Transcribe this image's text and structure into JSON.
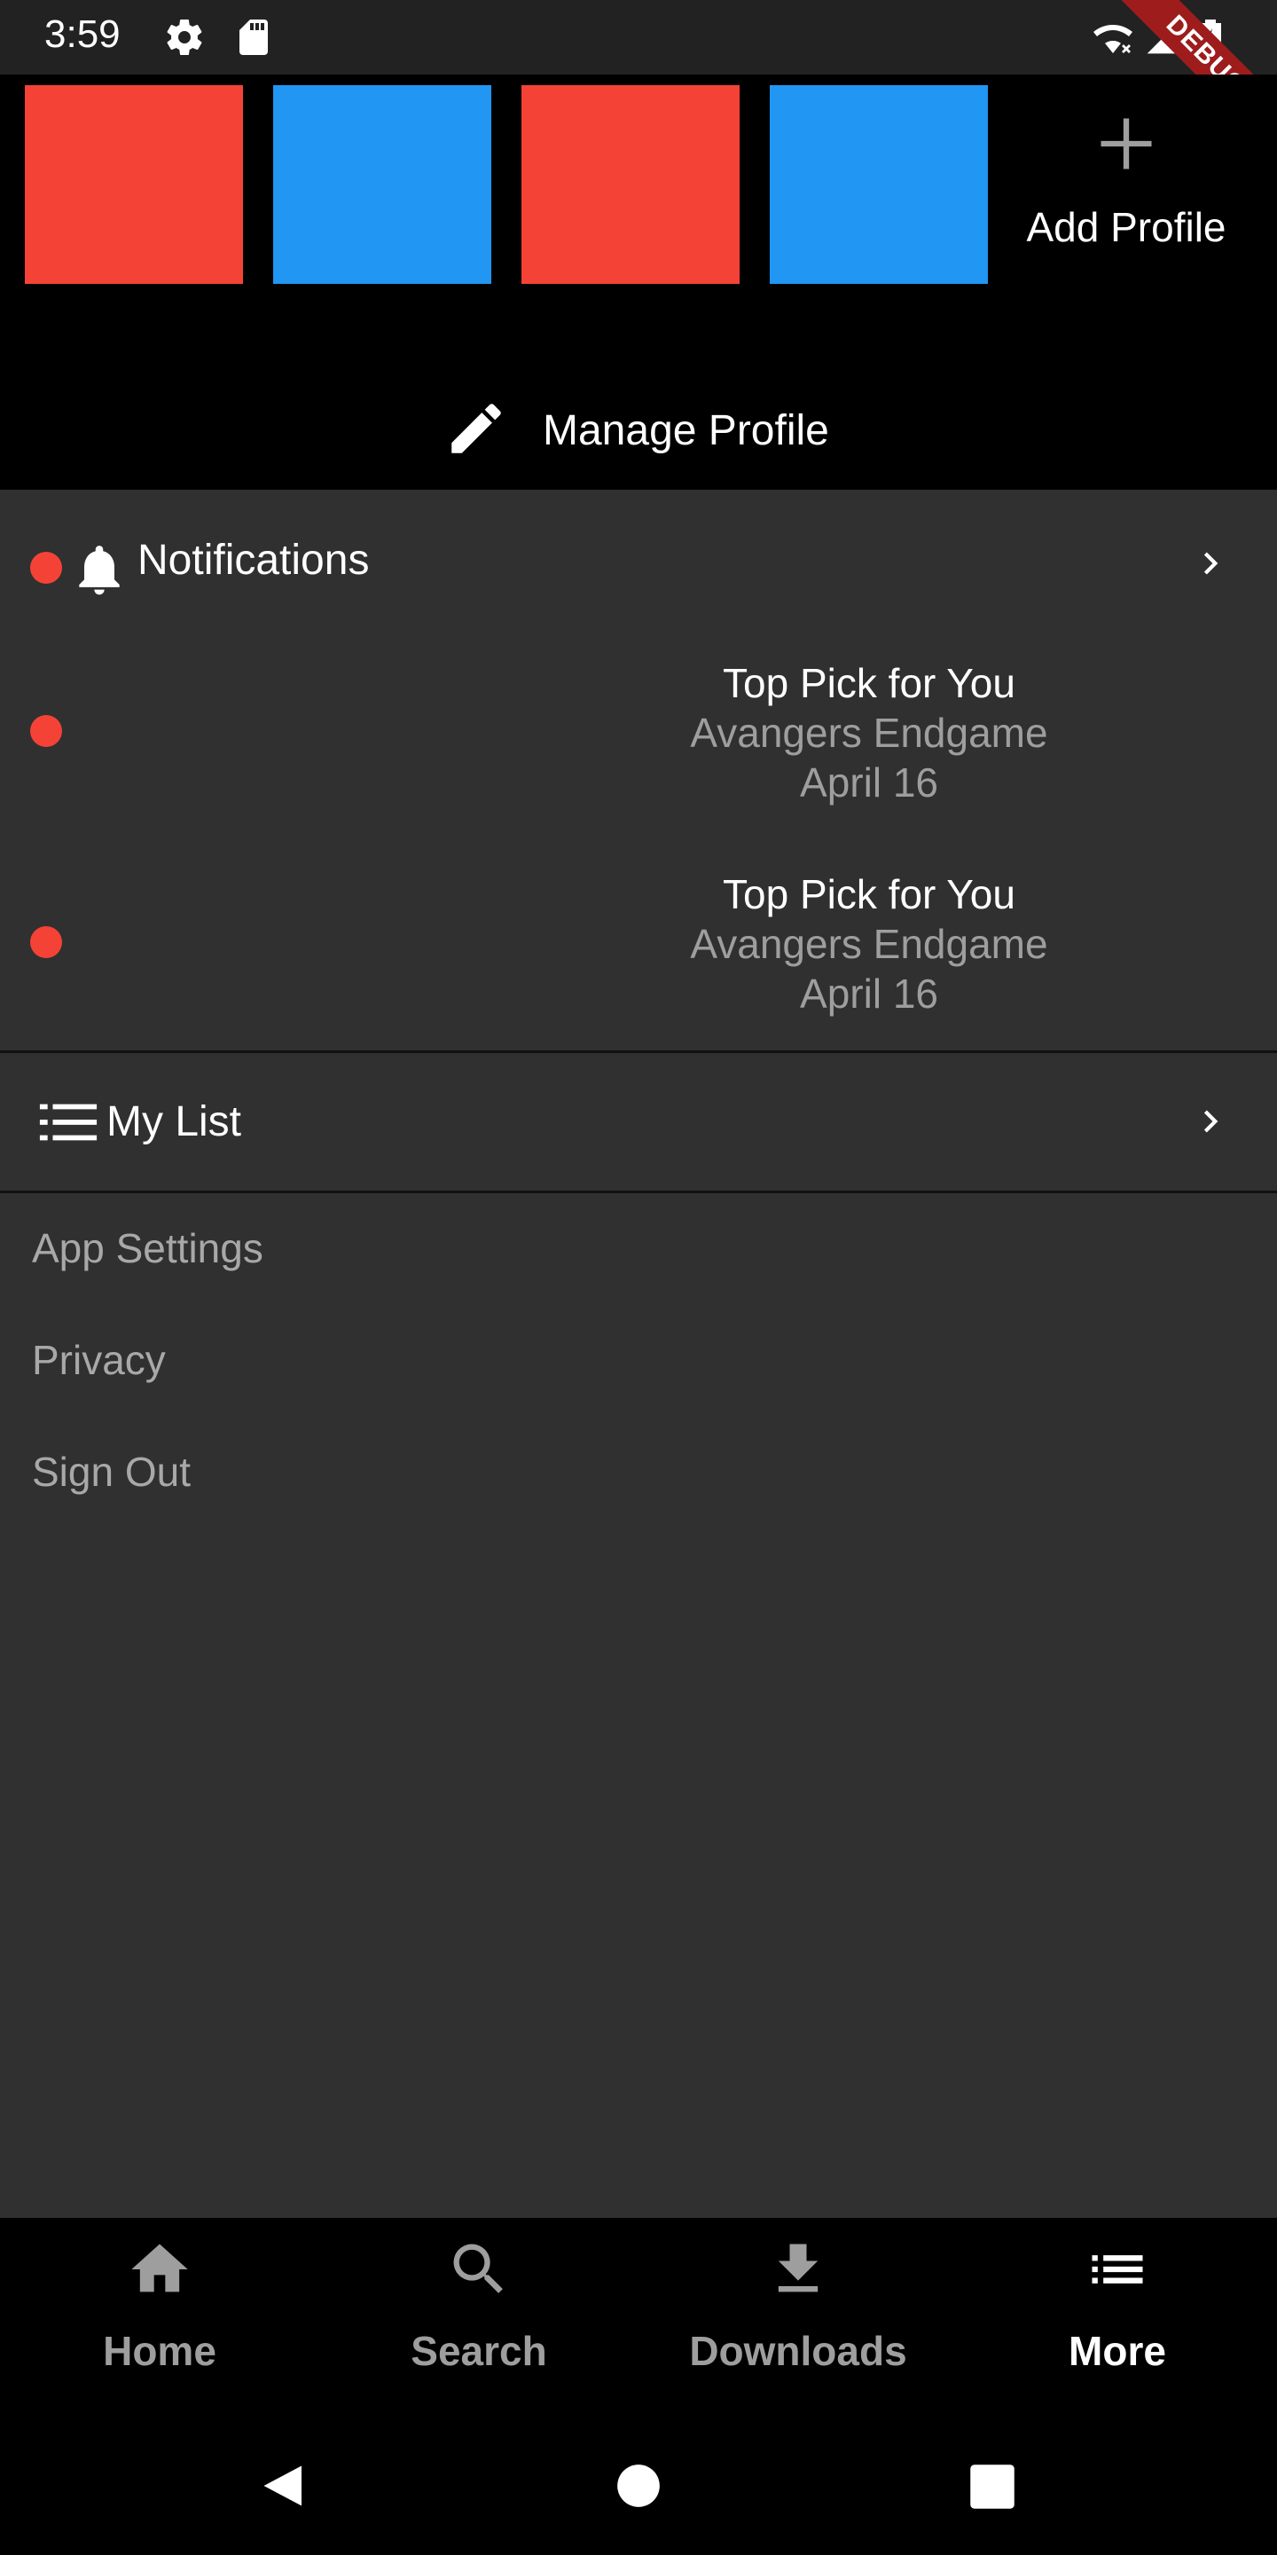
{
  "status_bar": {
    "time": "3:59",
    "debug_label": "DEBUG",
    "icons": [
      "settings-icon",
      "sd-card-icon",
      "wifi-off-icon",
      "signal-icon",
      "battery-charging-icon"
    ]
  },
  "profiles": {
    "tiles": [
      {
        "color": "#f44336"
      },
      {
        "color": "#2196f3"
      },
      {
        "color": "#f44336"
      },
      {
        "color": "#2196f3"
      }
    ],
    "add_label": "Add Profile",
    "manage_label": "Manage Profile"
  },
  "notifications": {
    "title": "Notifications",
    "items": [
      {
        "title": "Top Pick for You",
        "subtitle": "Avangers Endgame",
        "date": "April 16"
      },
      {
        "title": "Top Pick for You",
        "subtitle": "Avangers Endgame",
        "date": "April 16"
      }
    ]
  },
  "my_list": {
    "label": "My List"
  },
  "menu": {
    "app_settings": "App Settings",
    "privacy": "Privacy",
    "sign_out": "Sign Out"
  },
  "bottom_nav": {
    "items": [
      {
        "label": "Home",
        "icon": "home-icon",
        "active": false
      },
      {
        "label": "Search",
        "icon": "search-icon",
        "active": false
      },
      {
        "label": "Downloads",
        "icon": "download-icon",
        "active": false
      },
      {
        "label": "More",
        "icon": "list-icon",
        "active": true
      }
    ]
  },
  "colors": {
    "accent_red": "#f44336",
    "accent_blue": "#2196f3",
    "background": "#303030",
    "header_bg": "#000000",
    "inactive_nav": "#9e9e9e"
  }
}
